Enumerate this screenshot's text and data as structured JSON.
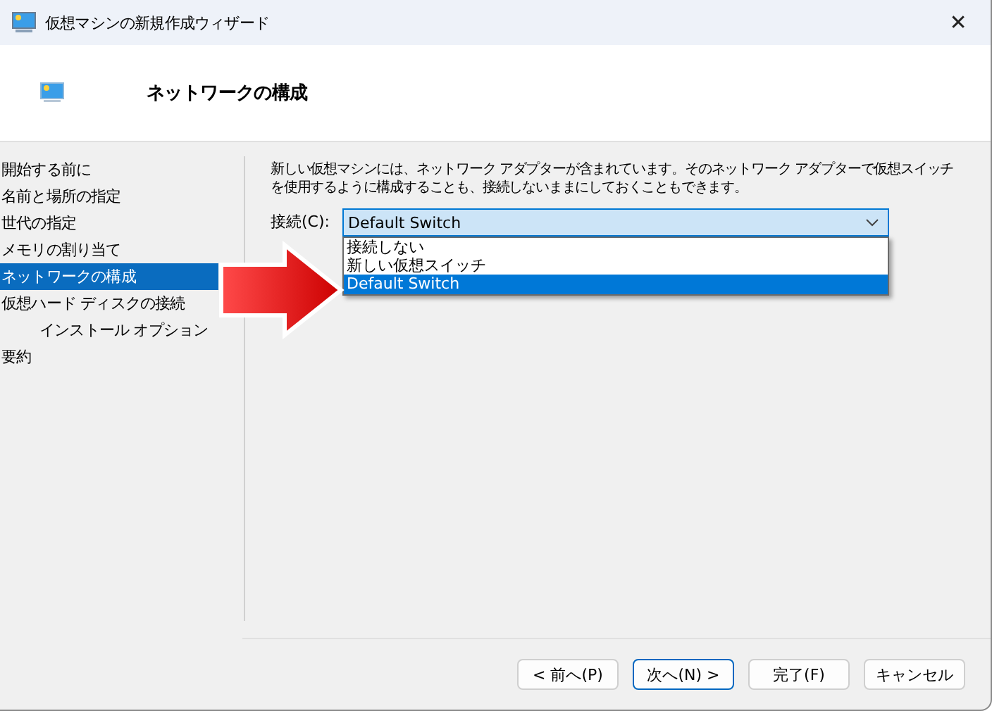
{
  "window": {
    "title": "仮想マシンの新規作成ウィザード",
    "close": "✕"
  },
  "header": {
    "title": "ネットワークの構成"
  },
  "sidebar": {
    "items": [
      {
        "label": "開始する前に",
        "selected": false
      },
      {
        "label": "名前と場所の指定",
        "selected": false
      },
      {
        "label": "世代の指定",
        "selected": false
      },
      {
        "label": "メモリの割り当て",
        "selected": false
      },
      {
        "label": "ネットワークの構成",
        "selected": true
      },
      {
        "label": "仮想ハード ディスクの接続",
        "selected": false,
        "children": [
          {
            "label": "インストール オプション",
            "selected": false
          }
        ]
      },
      {
        "label": "要約",
        "selected": false
      }
    ]
  },
  "content": {
    "description": "新しい仮想マシンには、ネットワーク アダプターが含まれています。そのネットワーク アダプターで仮想スイッチを使用するように構成することも、接続しないままにしておくこともできます。",
    "connection": {
      "label": "接続(C):",
      "value": "Default Switch",
      "expanded": true,
      "options": [
        {
          "label": "接続しない",
          "selected": false
        },
        {
          "label": "新しい仮想スイッチ",
          "selected": false
        },
        {
          "label": "Default Switch",
          "selected": true
        }
      ]
    }
  },
  "buttons": [
    {
      "label": "< 前へ(P)",
      "default": false
    },
    {
      "label": "次へ(N) >",
      "default": true
    },
    {
      "label": "完了(F)",
      "default": false
    },
    {
      "label": "キャンセル",
      "default": false
    }
  ]
}
